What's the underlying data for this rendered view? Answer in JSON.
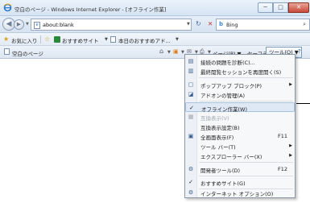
{
  "window": {
    "title": "空白のページ - Windows Internet Explorer - [オフライン作業]",
    "min_label": "─",
    "max_label": "□",
    "close_label": "✕"
  },
  "address_bar": {
    "url": "about:blank",
    "search_placeholder": "Bing",
    "search_icon": "magnifier-icon",
    "refresh_glyph": "↻",
    "stop_glyph": "✕"
  },
  "favorites_bar": {
    "favorites_label": "お気に入り",
    "suggested_sites_label": "おすすめサイト",
    "today_label": "本日のおすすめアド..."
  },
  "command_bar": {
    "tab_title": "空白のページ",
    "page_label": "ページ(P)",
    "safety_label": "セーフティ(S)",
    "tools_label": "ツール(O)",
    "help_glyph": "?"
  },
  "tools_menu": {
    "items": [
      {
        "label": "接続の問題を診断(C)...",
        "icon": "diagnose-icon",
        "shortcut": "",
        "submenu": false,
        "enabled": true,
        "checked": false
      },
      {
        "label": "最終閲覧セッションを再度開く(S)",
        "icon": "reopen-icon",
        "shortcut": "",
        "submenu": false,
        "enabled": true,
        "checked": false
      },
      {
        "label": "ポップアップ ブロック(P)",
        "icon": "popup-icon",
        "shortcut": "",
        "submenu": true,
        "enabled": true,
        "checked": false
      },
      {
        "label": "アドオンの管理(A)",
        "icon": "addon-icon",
        "shortcut": "",
        "submenu": false,
        "enabled": true,
        "checked": false
      },
      {
        "label": "オフライン作業(W)",
        "icon": "check-icon",
        "shortcut": "",
        "submenu": false,
        "enabled": true,
        "checked": true
      },
      {
        "label": "互換表示(V)",
        "icon": "compat-icon",
        "shortcut": "",
        "submenu": false,
        "enabled": false,
        "checked": false
      },
      {
        "label": "互換表示設定(B)",
        "icon": "",
        "shortcut": "",
        "submenu": false,
        "enabled": true,
        "checked": false
      },
      {
        "label": "全画面表示(F)",
        "icon": "fullscreen-icon",
        "shortcut": "F11",
        "submenu": false,
        "enabled": true,
        "checked": false
      },
      {
        "label": "ツール バー(T)",
        "icon": "",
        "shortcut": "",
        "submenu": true,
        "enabled": true,
        "checked": false
      },
      {
        "label": "エクスプローラー バー(X)",
        "icon": "",
        "shortcut": "",
        "submenu": true,
        "enabled": true,
        "checked": false
      },
      {
        "label": "開発者ツール(D)",
        "icon": "devtools-icon",
        "shortcut": "F12",
        "submenu": false,
        "enabled": true,
        "checked": false
      },
      {
        "label": "おすすめサイト(G)",
        "icon": "check-icon",
        "shortcut": "",
        "submenu": false,
        "enabled": true,
        "checked": true
      },
      {
        "label": "インターネット オプション(O)",
        "icon": "options-icon",
        "shortcut": "",
        "submenu": false,
        "enabled": true,
        "checked": false
      }
    ]
  }
}
